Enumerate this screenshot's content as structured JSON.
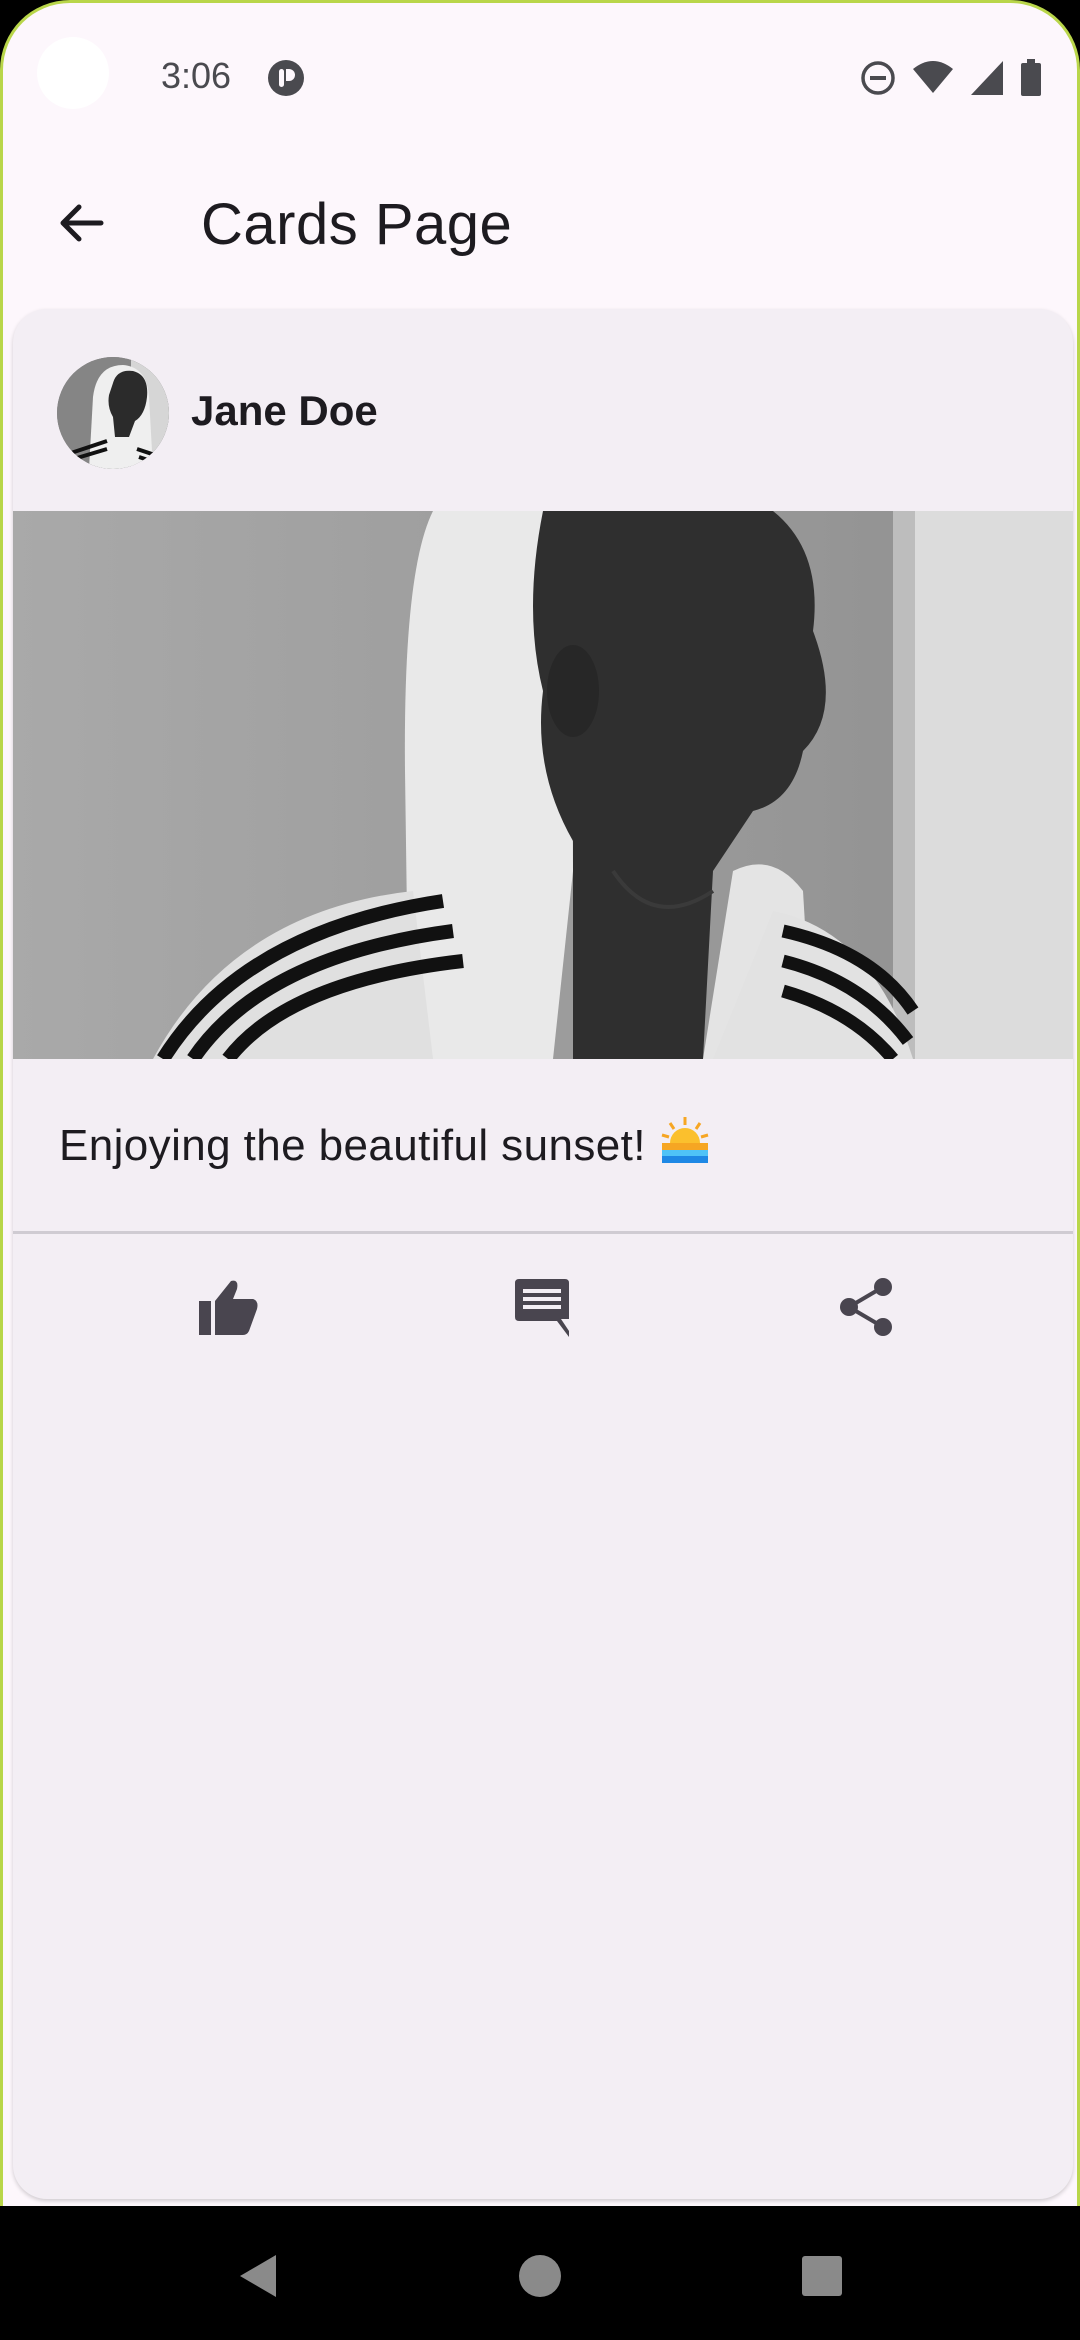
{
  "status_bar": {
    "time": "3:06",
    "icons": [
      "do-not-disturb-icon",
      "wifi-icon",
      "cellular-signal-icon",
      "battery-icon"
    ]
  },
  "app_bar": {
    "back_icon": "arrow-back-icon",
    "title": "Cards Page"
  },
  "card": {
    "author": "Jane Doe",
    "caption": "Enjoying the beautiful sunset!",
    "caption_emoji": "🌅",
    "actions": [
      {
        "icon": "thumb-up-icon"
      },
      {
        "icon": "comment-icon"
      },
      {
        "icon": "share-icon"
      }
    ]
  },
  "nav_bar": {
    "buttons": [
      "back-triangle-icon",
      "home-circle-icon",
      "recents-square-icon"
    ]
  },
  "colors": {
    "screen_bg": "#fdf7fc",
    "card_bg": "#f3eef4",
    "text": "#1d1b20",
    "icon": "#49454f",
    "frame_accent": "#b9d64a"
  }
}
